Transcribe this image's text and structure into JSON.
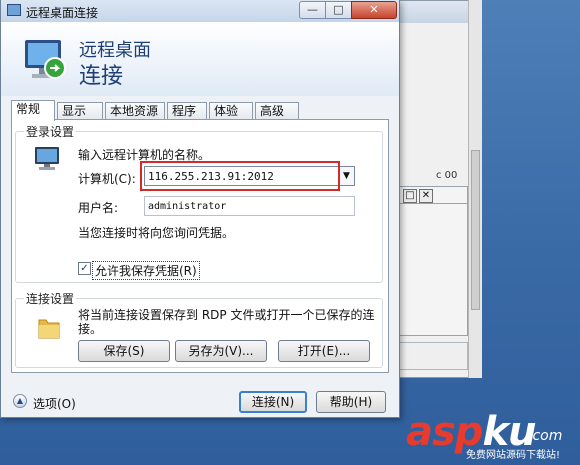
{
  "window": {
    "title": "远程桌面连接",
    "min_label": "—",
    "max_label": "□",
    "close_label": "✕"
  },
  "header": {
    "line1": "远程桌面",
    "line2": "连接"
  },
  "tabs": [
    {
      "label": "常规",
      "active": true
    },
    {
      "label": "显示"
    },
    {
      "label": "本地资源"
    },
    {
      "label": "程序"
    },
    {
      "label": "体验"
    },
    {
      "label": "高级"
    }
  ],
  "login": {
    "legend": "登录设置",
    "prompt": "输入远程计算机的名称。",
    "computer_label": "计算机(C):",
    "computer_value": "116.255.213.91:2012",
    "username_label": "用户名:",
    "username_value": "administrator",
    "hint": "当您连接时将向您询问凭据。",
    "save_credentials_label": "允许我保存凭据(R)",
    "save_credentials_checked": "✓"
  },
  "connection": {
    "legend": "连接设置",
    "description": "将当前连接设置保存到 RDP 文件或打开一个已保存的连接。",
    "save_label": "保存(S)",
    "saveas_label": "另存为(V)...",
    "open_label": "打开(E)..."
  },
  "footer": {
    "options_label": "选项(O)",
    "connect_label": "连接(N)",
    "help_label": "帮助(H)"
  },
  "background": {
    "ctrl_restore": "□",
    "ctrl_close": "✕",
    "side_text": "c 00"
  },
  "watermark": {
    "part_a": "asp",
    "part_b": "ku",
    "suffix": ".com",
    "tagline": "免费网站源码下载站!"
  },
  "colors": {
    "highlight": "#d42a2a",
    "title_text": "#1e3f74",
    "watermark_red": "#e63b2e"
  },
  "icons": [
    "computer-icon",
    "folder-icon",
    "remote-desktop-icon",
    "chevron-up-icon",
    "dropdown-arrow-icon"
  ]
}
